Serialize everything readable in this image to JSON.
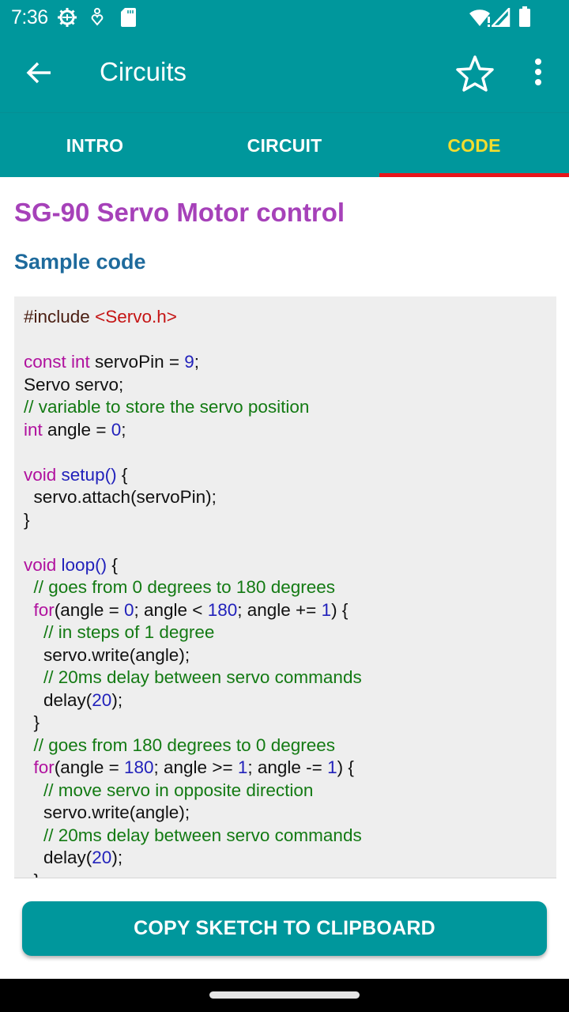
{
  "status_bar": {
    "time": "7:36",
    "left_icons": [
      "settings-gear-icon",
      "accessibility-icon",
      "sd-card-icon"
    ],
    "right_icons": [
      "wifi-alert-icon",
      "cell-signal-icon",
      "battery-icon"
    ]
  },
  "app_bar": {
    "title": "Circuits",
    "back_icon": "arrow-left-icon",
    "favorite_icon": "star-outline-icon",
    "more_icon": "more-vert-icon"
  },
  "tabs": [
    {
      "label": "INTRO",
      "active": false
    },
    {
      "label": "CIRCUIT",
      "active": false
    },
    {
      "label": "CODE",
      "active": true
    }
  ],
  "content": {
    "title": "SG-90 Servo Motor control",
    "section_title": "Sample code",
    "code_lines": [
      [
        {
          "t": "pp",
          "v": "#include "
        },
        {
          "t": "str",
          "v": "<Servo.h>"
        }
      ],
      [],
      [
        {
          "t": "kw",
          "v": "const int"
        },
        {
          "t": "",
          "v": " servoPin = "
        },
        {
          "t": "num",
          "v": "9"
        },
        {
          "t": "",
          "v": ";"
        }
      ],
      [
        {
          "t": "",
          "v": "Servo servo;"
        }
      ],
      [
        {
          "t": "cm",
          "v": "// variable to store the servo position"
        }
      ],
      [
        {
          "t": "kw",
          "v": "int"
        },
        {
          "t": "",
          "v": " angle = "
        },
        {
          "t": "num",
          "v": "0"
        },
        {
          "t": "",
          "v": ";"
        }
      ],
      [],
      [
        {
          "t": "kw",
          "v": "void"
        },
        {
          "t": "",
          "v": " "
        },
        {
          "t": "fn",
          "v": "setup()"
        },
        {
          "t": "",
          "v": " {"
        }
      ],
      [
        {
          "t": "",
          "v": "  servo.attach(servoPin);"
        }
      ],
      [
        {
          "t": "",
          "v": "}"
        }
      ],
      [],
      [
        {
          "t": "kw",
          "v": "void"
        },
        {
          "t": "",
          "v": " "
        },
        {
          "t": "fn",
          "v": "loop()"
        },
        {
          "t": "",
          "v": " {"
        }
      ],
      [
        {
          "t": "",
          "v": "  "
        },
        {
          "t": "cm",
          "v": "// goes from 0 degrees to 180 degrees"
        }
      ],
      [
        {
          "t": "",
          "v": "  "
        },
        {
          "t": "kw",
          "v": "for"
        },
        {
          "t": "",
          "v": "(angle = "
        },
        {
          "t": "num",
          "v": "0"
        },
        {
          "t": "",
          "v": "; angle < "
        },
        {
          "t": "num",
          "v": "180"
        },
        {
          "t": "",
          "v": "; angle += "
        },
        {
          "t": "num",
          "v": "1"
        },
        {
          "t": "",
          "v": ") {"
        }
      ],
      [
        {
          "t": "",
          "v": "    "
        },
        {
          "t": "cm",
          "v": "// in steps of 1 degree"
        }
      ],
      [
        {
          "t": "",
          "v": "    servo.write(angle);"
        }
      ],
      [
        {
          "t": "",
          "v": "    "
        },
        {
          "t": "cm",
          "v": "// 20ms delay between servo commands"
        }
      ],
      [
        {
          "t": "",
          "v": "    delay("
        },
        {
          "t": "num",
          "v": "20"
        },
        {
          "t": "",
          "v": ");"
        }
      ],
      [
        {
          "t": "",
          "v": "  }"
        }
      ],
      [
        {
          "t": "",
          "v": "  "
        },
        {
          "t": "cm",
          "v": "// goes from 180 degrees to 0 degrees"
        }
      ],
      [
        {
          "t": "",
          "v": "  "
        },
        {
          "t": "kw",
          "v": "for"
        },
        {
          "t": "",
          "v": "(angle = "
        },
        {
          "t": "num",
          "v": "180"
        },
        {
          "t": "",
          "v": "; angle >= "
        },
        {
          "t": "num",
          "v": "1"
        },
        {
          "t": "",
          "v": "; angle -= "
        },
        {
          "t": "num",
          "v": "1"
        },
        {
          "t": "",
          "v": ") {"
        }
      ],
      [
        {
          "t": "",
          "v": "    "
        },
        {
          "t": "cm",
          "v": "// move servo in opposite direction"
        }
      ],
      [
        {
          "t": "",
          "v": "    servo.write(angle);"
        }
      ],
      [
        {
          "t": "",
          "v": "    "
        },
        {
          "t": "cm",
          "v": "// 20ms delay between servo commands"
        }
      ],
      [
        {
          "t": "",
          "v": "    delay("
        },
        {
          "t": "num",
          "v": "20"
        },
        {
          "t": "",
          "v": ");"
        }
      ],
      [
        {
          "t": "",
          "v": "  }"
        }
      ]
    ]
  },
  "copy_button": {
    "label": "COPY SKETCH TO CLIPBOARD"
  },
  "colors": {
    "primary": "#00979C",
    "tab_active_text": "#F2DC2E",
    "tab_indicator": "#E9141A",
    "title": "#A641B9",
    "section_title": "#1E6A9C",
    "code_background": "#EEEEEE",
    "keyword": "#B0119E",
    "number": "#2222BB",
    "comment": "#137A13",
    "string": "#C51515"
  }
}
